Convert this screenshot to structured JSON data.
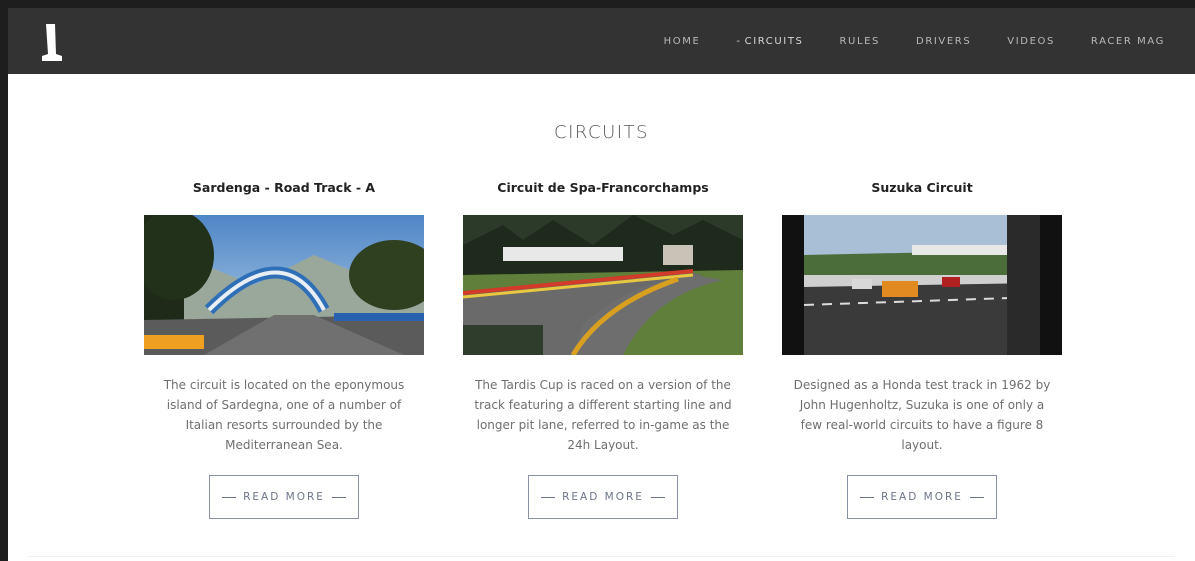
{
  "nav": {
    "items": [
      {
        "label": "HOME",
        "active": false
      },
      {
        "label": "CIRCUITS",
        "active": true
      },
      {
        "label": "RULES",
        "active": false
      },
      {
        "label": "DRIVERS",
        "active": false
      },
      {
        "label": "VIDEOS",
        "active": false
      },
      {
        "label": "RACER MAG",
        "active": false
      }
    ],
    "active_marker": "-"
  },
  "page": {
    "title": "CIRCUITS"
  },
  "cards": [
    {
      "title": "Sardenga - Road Track - A",
      "description": "The circuit is located on the eponymous island of Sardegna, one of a number of Italian resorts surrounded by the Mediterranean Sea.",
      "button": "READ MORE"
    },
    {
      "title": "Circuit de Spa-Francorchamps",
      "description": "The Tardis Cup is raced on a version of the track featuring a different starting line and longer pit lane, referred to in-game as the 24h Layout.",
      "button": "READ MORE"
    },
    {
      "title": "Suzuka Circuit",
      "description": "Designed as a Honda test track in 1962 by John Hugenholtz, Suzuka is one of only a few real-world circuits to have a figure 8 layout.",
      "button": "READ MORE"
    }
  ],
  "colors": {
    "navbar_bg": "#333333",
    "accent_button": "#6c7488",
    "body_text": "#6f6f6f"
  }
}
